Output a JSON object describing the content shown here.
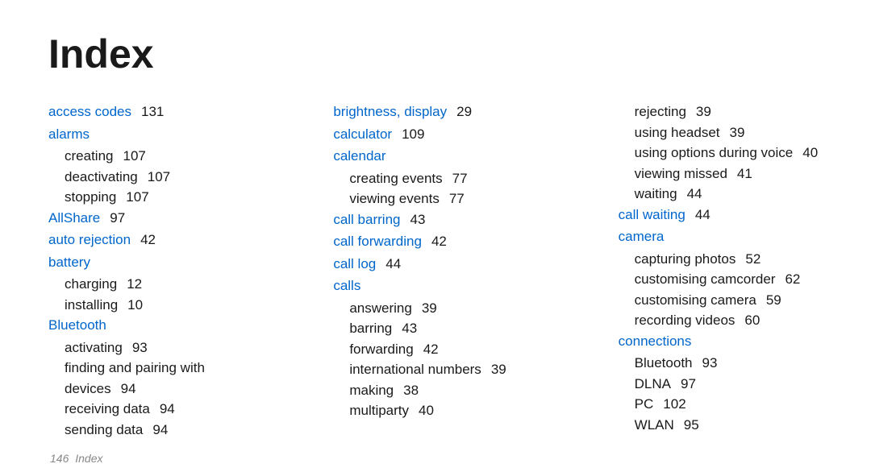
{
  "title": "Index",
  "footer": {
    "page": "146",
    "label": "Index"
  },
  "col1": {
    "access_codes": {
      "term": "access codes",
      "page": "131"
    },
    "alarms": {
      "term": "alarms"
    },
    "alarms_creating": {
      "sub": "creating",
      "page": "107"
    },
    "alarms_deactivating": {
      "sub": "deactivating",
      "page": "107"
    },
    "alarms_stopping": {
      "sub": "stopping",
      "page": "107"
    },
    "allshare": {
      "term": "AllShare",
      "page": "97"
    },
    "auto_rejection": {
      "term": "auto rejection",
      "page": "42"
    },
    "battery": {
      "term": "battery"
    },
    "battery_charging": {
      "sub": "charging",
      "page": "12"
    },
    "battery_installing": {
      "sub": "installing",
      "page": "10"
    },
    "bluetooth": {
      "term": "Bluetooth"
    },
    "bluetooth_activating": {
      "sub": "activating",
      "page": "93"
    },
    "bluetooth_finding_line1": "finding and pairing with",
    "bluetooth_finding_line2": {
      "sub": "devices",
      "page": "94"
    },
    "bluetooth_receiving": {
      "sub": "receiving data",
      "page": "94"
    },
    "bluetooth_sending": {
      "sub": "sending data",
      "page": "94"
    }
  },
  "col2": {
    "brightness": {
      "term": "brightness, display",
      "page": "29"
    },
    "calculator": {
      "term": "calculator",
      "page": "109"
    },
    "calendar": {
      "term": "calendar"
    },
    "calendar_creating": {
      "sub": "creating events",
      "page": "77"
    },
    "calendar_viewing": {
      "sub": "viewing events",
      "page": "77"
    },
    "call_barring": {
      "term": "call barring",
      "page": "43"
    },
    "call_forwarding": {
      "term": "call forwarding",
      "page": "42"
    },
    "call_log": {
      "term": "call log",
      "page": "44"
    },
    "calls": {
      "term": "calls"
    },
    "calls_answering": {
      "sub": "answering",
      "page": "39"
    },
    "calls_barring": {
      "sub": "barring",
      "page": "43"
    },
    "calls_forwarding": {
      "sub": "forwarding",
      "page": "42"
    },
    "calls_intl": {
      "sub": "international numbers",
      "page": "39"
    },
    "calls_making": {
      "sub": "making",
      "page": "38"
    },
    "calls_multiparty": {
      "sub": "multiparty",
      "page": "40"
    }
  },
  "col3": {
    "calls_rejecting": {
      "sub": "rejecting",
      "page": "39"
    },
    "calls_headset": {
      "sub": "using headset",
      "page": "39"
    },
    "calls_options": {
      "sub": "using options during voice",
      "page": "40"
    },
    "calls_missed": {
      "sub": "viewing missed",
      "page": "41"
    },
    "calls_waiting": {
      "sub": "waiting",
      "page": "44"
    },
    "call_waiting": {
      "term": "call waiting",
      "page": "44"
    },
    "camera": {
      "term": "camera"
    },
    "camera_capturing": {
      "sub": "capturing photos",
      "page": "52"
    },
    "camera_camcorder": {
      "sub": "customising camcorder",
      "page": "62"
    },
    "camera_custom": {
      "sub": "customising camera",
      "page": "59"
    },
    "camera_recording": {
      "sub": "recording videos",
      "page": "60"
    },
    "connections": {
      "term": "connections"
    },
    "connections_bt": {
      "sub": "Bluetooth",
      "page": "93"
    },
    "connections_dlna": {
      "sub": "DLNA",
      "page": "97"
    },
    "connections_pc": {
      "sub": "PC",
      "page": "102"
    },
    "connections_wlan": {
      "sub": "WLAN",
      "page": "95"
    }
  }
}
